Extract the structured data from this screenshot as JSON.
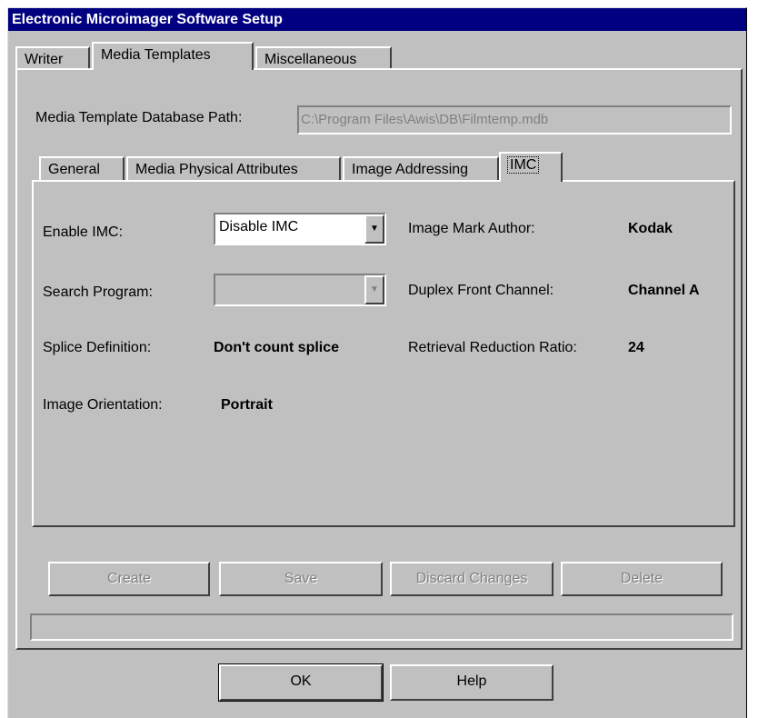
{
  "window": {
    "title": "Electronic Microimager Software Setup"
  },
  "outer_tabs": [
    {
      "label": "Writer",
      "active": false
    },
    {
      "label": "Media Templates",
      "active": true
    },
    {
      "label": "Miscellaneous",
      "active": false
    }
  ],
  "db_path": {
    "label": "Media Template Database Path:",
    "value": "C:\\Program Files\\Awis\\DB\\Filmtemp.mdb"
  },
  "inner_tabs": [
    {
      "label": "General",
      "active": false
    },
    {
      "label": "Media Physical Attributes",
      "active": false
    },
    {
      "label": "Image Addressing",
      "active": false
    },
    {
      "label": "IMC",
      "active": true
    }
  ],
  "imc": {
    "enable_imc": {
      "label": "Enable IMC:",
      "value": "Disable IMC"
    },
    "search_program": {
      "label": "Search Program:",
      "value": ""
    },
    "splice_definition": {
      "label": "Splice Definition:",
      "value": "Don't count splice"
    },
    "image_orientation": {
      "label": "Image Orientation:",
      "value": "Portrait"
    },
    "image_mark_author": {
      "label": "Image Mark Author:",
      "value": "Kodak"
    },
    "duplex_front_channel": {
      "label": "Duplex Front Channel:",
      "value": "Channel A"
    },
    "retrieval_reduction_ratio": {
      "label": "Retrieval Reduction Ratio:",
      "value": "24"
    }
  },
  "buttons": {
    "create": "Create",
    "save": "Save",
    "discard": "Discard Changes",
    "delete": "Delete",
    "ok": "OK",
    "help": "Help"
  },
  "status_bar": {
    "text": ""
  },
  "icons": {
    "dropdown": "chevron-down-icon"
  }
}
